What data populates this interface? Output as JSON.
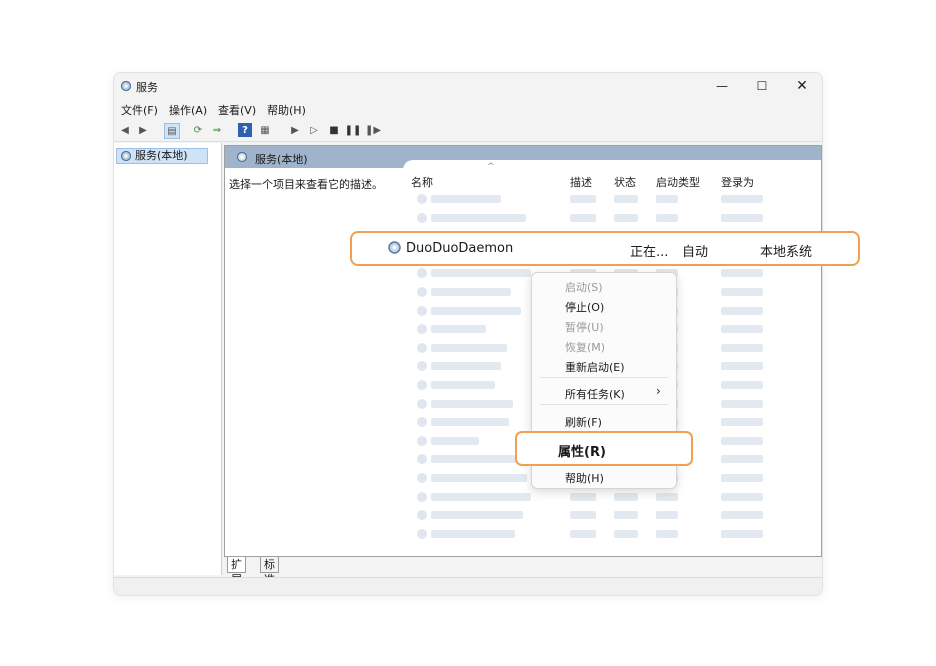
{
  "window": {
    "title": "服务"
  },
  "menubar": [
    "文件(F)",
    "操作(A)",
    "查看(V)",
    "帮助(H)"
  ],
  "tree": {
    "item": "服务(本地)"
  },
  "pane": {
    "header": "服务(本地)",
    "description_hint": "选择一个项目来查看它的描述。"
  },
  "columns": {
    "name": "名称",
    "desc": "描述",
    "status": "状态",
    "startup": "启动类型",
    "logon": "登录为"
  },
  "highlighted_service": {
    "name": "DuoDuoDaemon",
    "status": "正在...",
    "startup": "自动",
    "logon": "本地系统"
  },
  "context_menu": {
    "start": "启动(S)",
    "stop": "停止(O)",
    "pause": "暂停(U)",
    "resume": "恢复(M)",
    "restart": "重新启动(E)",
    "all_tasks": "所有任务(K)",
    "refresh": "刷新(F)",
    "properties": "属性(R)",
    "help": "帮助(H)"
  },
  "tabs": [
    "扩展",
    "标准"
  ],
  "colors": {
    "highlight_border": "#f0a050",
    "pane_header": "#9fb4cb"
  }
}
